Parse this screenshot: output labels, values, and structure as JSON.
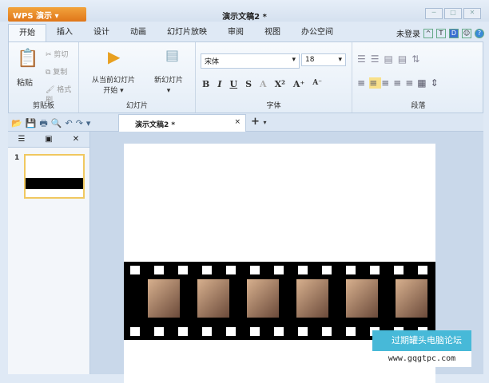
{
  "app": {
    "button": "WPS 演示",
    "title": "演示文稿2 *"
  },
  "tabs": [
    "开始",
    "插入",
    "设计",
    "动画",
    "幻灯片放映",
    "审阅",
    "视图",
    "办公空间"
  ],
  "account": "未登录",
  "ribbon": {
    "clipboard": {
      "label": "剪贴板",
      "paste": "粘贴",
      "cut": "剪切",
      "copy": "复制",
      "format_painter": "格式刷"
    },
    "slides": {
      "label": "幻灯片",
      "from_current": "从当前幻灯片",
      "from_current2": "开始",
      "new_slide": "新幻灯片"
    },
    "font": {
      "label": "字体",
      "name": "宋体",
      "size": "18",
      "bold": "B",
      "italic": "I",
      "underline": "U",
      "strike": "S"
    },
    "paragraph": {
      "label": "段落"
    }
  },
  "document_tab": {
    "title": "演示文稿2 *",
    "close": "×",
    "new": "+"
  },
  "slide_panel": {
    "slide_number": "1"
  },
  "watermark": {
    "name": "过期罐头电脑论坛",
    "url": "www.gqgtpc.com"
  },
  "colors": {
    "app_button": "#e0761a",
    "selected_slide": "#f0c860"
  }
}
